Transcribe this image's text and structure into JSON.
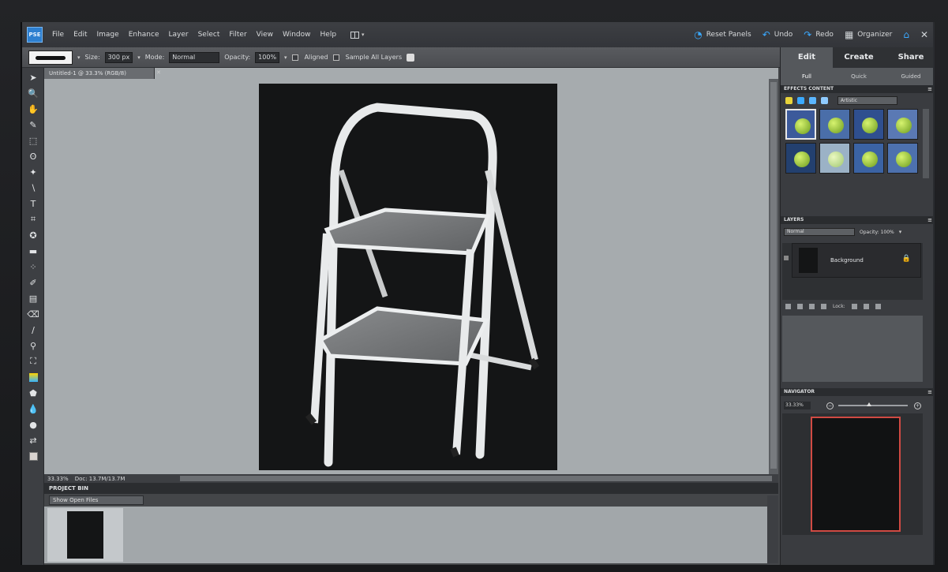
{
  "app": {
    "logo_text": "PSE"
  },
  "menu": {
    "items": [
      "File",
      "Edit",
      "Image",
      "Enhance",
      "Layer",
      "Select",
      "Filter",
      "View",
      "Window",
      "Help"
    ]
  },
  "actions": {
    "reset_panels": "Reset Panels",
    "undo": "Undo",
    "redo": "Redo",
    "organizer": "Organizer"
  },
  "options": {
    "size_label": "Size:",
    "size_value": "300 px",
    "mode_label": "Mode:",
    "mode_value": "Normal",
    "opacity_label": "Opacity:",
    "opacity_value": "100%",
    "aligned": "Aligned",
    "sample_all": "Sample All Layers"
  },
  "document": {
    "tab_title": "Untitled-1 @ 33.3% (RGB/8)",
    "zoom_status": "33.33%",
    "doc_info": "Doc: 13.7M/13.7M"
  },
  "bin": {
    "title": "PROJECT BIN",
    "select_value": "Show Open Files"
  },
  "right_panel": {
    "mode_tabs": [
      "Edit",
      "Create",
      "Share"
    ],
    "sub_tabs": [
      "Full",
      "Quick",
      "Guided"
    ],
    "effects_head": "EFFECTS    CONTENT",
    "effects_select": "Artistic",
    "layers_head": "LAYERS",
    "blend_value": "Normal",
    "opacity_text": "Opacity: 100%",
    "layer_name": "Background",
    "layers_footer_text": "Lock:",
    "navigator_head": "NAVIGATOR",
    "nav_zoom": "33.33%"
  },
  "colors": {
    "accent_blue": "#3aa9ff",
    "nav_frame": "#d04a43",
    "canvas_bg": "#a6abae"
  }
}
